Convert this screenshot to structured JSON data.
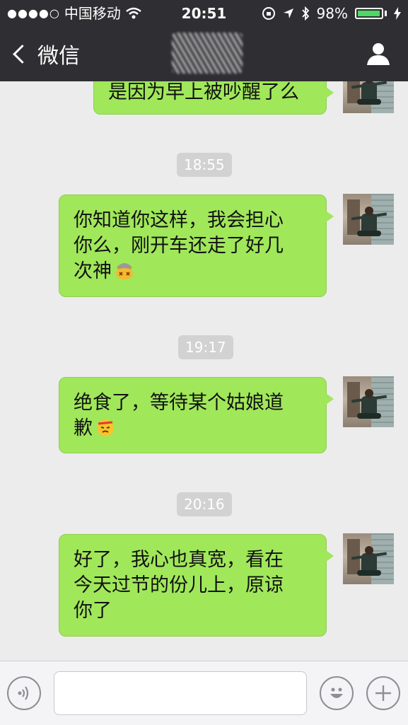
{
  "status_bar": {
    "carrier": "中国移动",
    "signal_dots": "●●●●○",
    "time": "20:51",
    "battery_percent": "98%",
    "battery_level": 0.98
  },
  "nav": {
    "back_label": "微信",
    "title": ""
  },
  "messages": [
    {
      "type": "text",
      "text": "是因为早上被吵醒了么"
    },
    {
      "type": "time",
      "text": "18:55"
    },
    {
      "type": "text",
      "lines": [
        "你知道你这样，我会担心",
        "你么，刚开车还走了好几",
        "次神"
      ],
      "emoji": "dizzy-face-emoji"
    },
    {
      "type": "time",
      "text": "19:17"
    },
    {
      "type": "text",
      "lines": [
        "绝食了，等待某个姑娘道",
        "歉"
      ],
      "emoji": "annoyed-face-emoji"
    },
    {
      "type": "time",
      "text": "20:16"
    },
    {
      "type": "text",
      "lines": [
        "好了，我心也真宽，看在",
        "今天过节的份儿上，原谅",
        "你了"
      ]
    }
  ],
  "input": {
    "value": "",
    "placeholder": ""
  },
  "colors": {
    "header_bg": "#2f2f33",
    "chat_bg": "#ececec",
    "bubble_bg": "#a0e75a",
    "time_label_bg": "#d2d2d2"
  },
  "icons": {
    "voice": "voice-icon",
    "emoji": "smiley-icon",
    "more": "plus-icon",
    "profile": "person-icon"
  }
}
